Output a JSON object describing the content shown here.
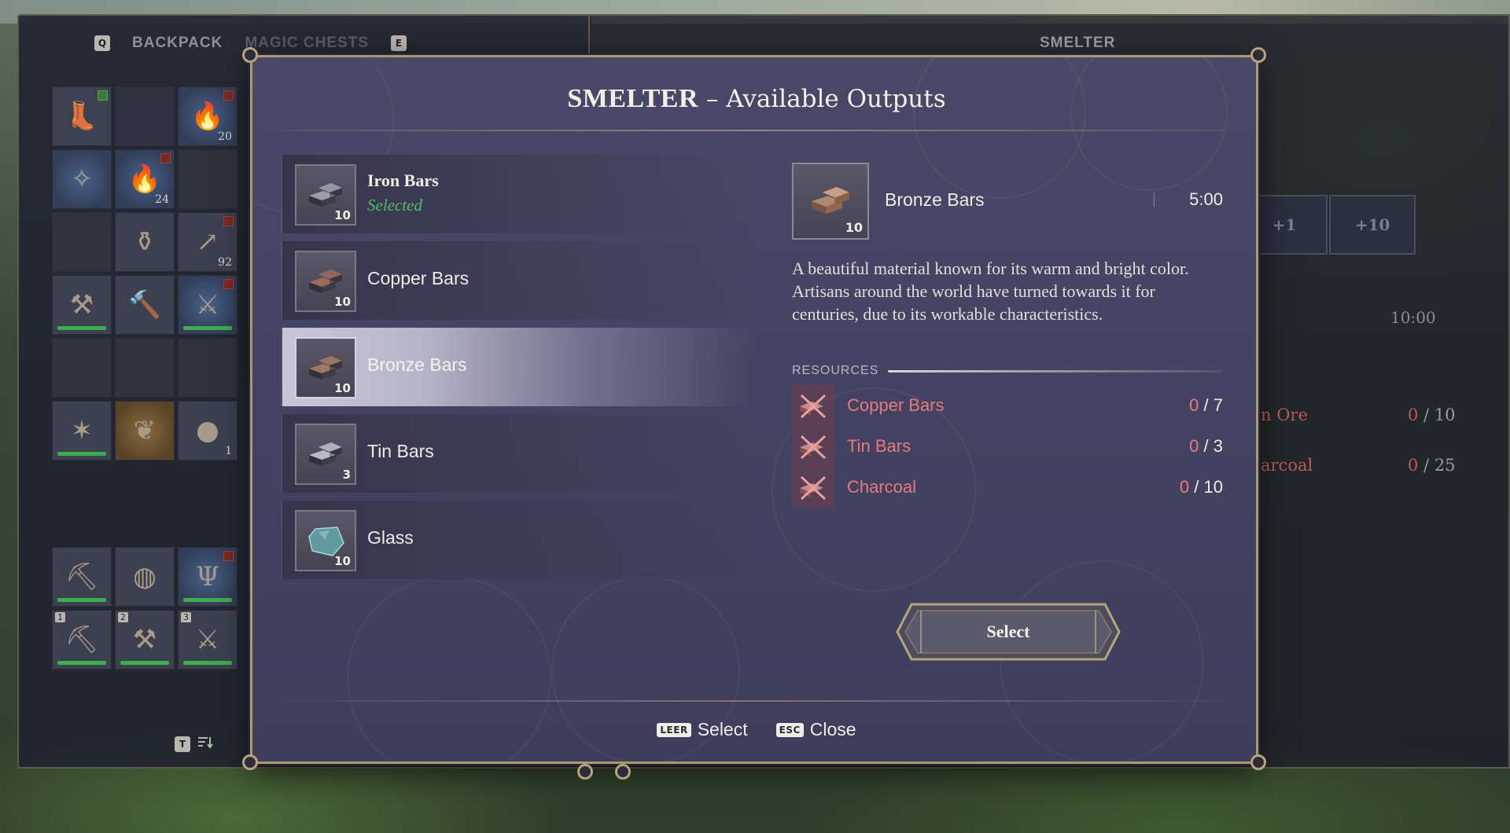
{
  "background": {
    "inventory_tabs": [
      {
        "key": "Q",
        "label": "BACKPACK"
      },
      {
        "key": "E",
        "label": "MAGIC CHESTS"
      }
    ],
    "inventory_slots": [
      {
        "item": "boots-icon",
        "tag": "green"
      },
      {
        "item": ""
      },
      {
        "item": "fire-icon",
        "count": "20",
        "tag": "red",
        "style": "blue"
      },
      {
        "item": "staff-icon",
        "style": "blue"
      },
      {
        "item": "fire-icon",
        "count": "24",
        "tag": "red",
        "style": "blue"
      },
      {
        "item": ""
      },
      {
        "item": ""
      },
      {
        "item": "pot-icon"
      },
      {
        "item": "spear-icon",
        "count": "92",
        "tag": "red"
      },
      {
        "item": "axe-icon",
        "bar": true
      },
      {
        "item": "hammer-icon"
      },
      {
        "item": "sword-icon",
        "bar": true,
        "tag": "red",
        "style": "blue"
      },
      {
        "item": ""
      },
      {
        "item": ""
      },
      {
        "item": ""
      },
      {
        "item": "mace-icon",
        "bar": true
      },
      {
        "item": "wings-icon",
        "style": "orange"
      },
      {
        "item": "eggs-icon",
        "count": "1"
      }
    ],
    "hotbar_slots": [
      {
        "item": "pickaxe-icon",
        "bar": true
      },
      {
        "item": "bag-icon"
      },
      {
        "item": "antler-icon",
        "bar": true,
        "tag": "red",
        "style": "blue"
      },
      {
        "num": "1",
        "item": "pickaxe-icon",
        "bar": true
      },
      {
        "num": "2",
        "item": "axe-icon",
        "bar": true
      },
      {
        "num": "3",
        "item": "sword-icon",
        "bar": true
      }
    ],
    "inventory_hint_key": "T",
    "smelter_title": "SMELTER",
    "qty_buttons": [
      "+1",
      "+10"
    ],
    "time": "10:00",
    "resources": [
      {
        "name": "n Ore",
        "have": "0",
        "need": "10"
      },
      {
        "name": "arcoal",
        "have": "0",
        "need": "25"
      }
    ]
  },
  "modal": {
    "title_strong": "SMELTER",
    "title_rest": " – Available Outputs",
    "outputs": [
      {
        "name": "Iron Bars",
        "count": "10",
        "status": "Selected",
        "icon": "iron-bars-icon",
        "color": "#9aa0ab"
      },
      {
        "name": "Copper Bars",
        "count": "10",
        "icon": "copper-bars-icon",
        "color": "#9a6a5a"
      },
      {
        "name": "Bronze Bars",
        "count": "10",
        "icon": "bronze-bars-icon",
        "color": "#a07a60",
        "active": true
      },
      {
        "name": "Tin Bars",
        "count": "3",
        "icon": "tin-bars-icon",
        "color": "#b6bcc8"
      },
      {
        "name": "Glass",
        "count": "10",
        "icon": "glass-icon",
        "color": "#5e9aa0"
      }
    ],
    "detail": {
      "name": "Bronze Bars",
      "count": "10",
      "time": "5:00",
      "description": "A beautiful material known for its warm and bright color. Artisans around the world have turned towards it for centuries, due to its workable characteristics.",
      "resources_label": "RESOURCES",
      "resources": [
        {
          "name": "Copper Bars",
          "have": "0",
          "need": "7",
          "icon": "copper-bars-icon"
        },
        {
          "name": "Tin Bars",
          "have": "0",
          "need": "3",
          "icon": "tin-bars-icon"
        },
        {
          "name": "Charcoal",
          "have": "0",
          "need": "10",
          "icon": "charcoal-icon"
        }
      ]
    },
    "select_label": "Select",
    "hints": [
      {
        "key": "LEER",
        "label": "Select"
      },
      {
        "key": "ESC",
        "label": "Close"
      }
    ]
  },
  "colors": {
    "modal_bg": "#444262",
    "frame_gold": "#a89a6e",
    "missing_resource": "#e67a7a",
    "selected_green": "#4cc26a"
  }
}
